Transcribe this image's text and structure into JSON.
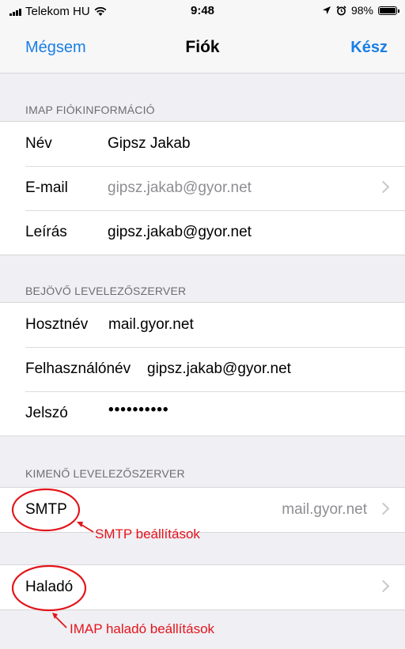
{
  "status_bar": {
    "carrier": "Telekom HU",
    "time": "9:48",
    "battery_percent": "98%",
    "battery_level": 0.98
  },
  "nav": {
    "cancel_label": "Mégsem",
    "title": "Fiók",
    "done_label": "Kész"
  },
  "imap_section": {
    "header": "IMAP FIÓKINFORMÁCIÓ",
    "rows": [
      {
        "label": "Név",
        "value": "Gipsz Jakab"
      },
      {
        "label": "E-mail",
        "value": "gipsz.jakab@gyor.net"
      },
      {
        "label": "Leírás",
        "value": "gipsz.jakab@gyor.net"
      }
    ]
  },
  "incoming_section": {
    "header": "BEJÖVŐ LEVELEZŐSZERVER",
    "rows": [
      {
        "label": "Hosztnév",
        "value": "mail.gyor.net"
      },
      {
        "label": "Felhasználónév",
        "value": "gipsz.jakab@gyor.net"
      },
      {
        "label": "Jelszó",
        "value": "••••••••••"
      }
    ]
  },
  "outgoing_section": {
    "header": "KIMENŐ LEVELEZŐSZERVER",
    "smtp_label": "SMTP",
    "smtp_value": "mail.gyor.net"
  },
  "advanced": {
    "label": "Haladó"
  },
  "annotations": {
    "smtp_note": "SMTP beállítások",
    "imap_note": "IMAP haladó beállítások",
    "color": "#e3141b"
  },
  "icons": {
    "wifi": "wifi-icon",
    "location": "location-arrow-icon",
    "alarm": "alarm-icon",
    "battery": "battery-icon",
    "chevron": "chevron-right-icon"
  }
}
